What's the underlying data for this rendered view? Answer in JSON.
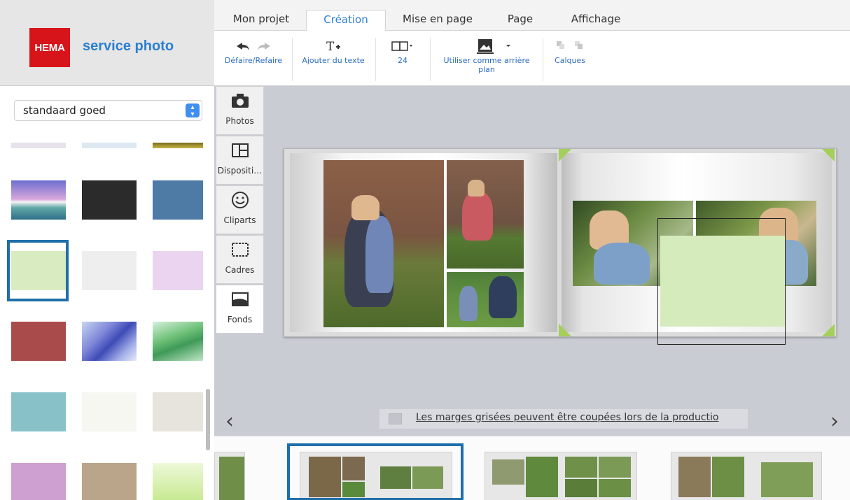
{
  "brand": {
    "logo_text": "HEMA",
    "name": "service photo",
    "logo_color": "#d8141b",
    "name_color": "#2b7fd0"
  },
  "tabs": [
    {
      "label": "Mon projet",
      "active": false
    },
    {
      "label": "Création",
      "active": true
    },
    {
      "label": "Mise en page",
      "active": false
    },
    {
      "label": "Page",
      "active": false
    },
    {
      "label": "Affichage",
      "active": false
    }
  ],
  "toolbar": {
    "undo_redo_label": "Défaire/Refaire",
    "add_text_label": "Ajouter du texte",
    "pages_count": "24",
    "use_background_label": "Utiliser comme arrière plan",
    "layers_label": "Calques"
  },
  "backgrounds": {
    "selected_option": "standaard goed",
    "selected_swatch_color": "#d9ebc0",
    "swatches": [
      "#e6e3ea",
      "#dde8f2",
      "#b69a2a",
      "#a7a9d6",
      "#2b2b2b",
      "#4e7aa6",
      "#d9ebc0",
      "#eeeeee",
      "#ead4ef",
      "#aa4b4b",
      "#8a8fd6",
      "#7fc086",
      "#88c2c8",
      "#f7f7f2",
      "#e7e4de",
      "#cda0d1",
      "#baa58b",
      "#d2ee9d"
    ]
  },
  "side_tools": [
    {
      "label": "Photos",
      "icon": "camera-icon"
    },
    {
      "label": "Dispositi…",
      "icon": "layout-icon"
    },
    {
      "label": "Cliparts",
      "icon": "smiley-icon"
    },
    {
      "label": "Cadres",
      "icon": "frame-icon"
    },
    {
      "label": "Fonds",
      "icon": "background-icon"
    }
  ],
  "canvas": {
    "margin_note": "Les marges grisées peuvent être coupées lors de la productio",
    "prev_arrow": "‹",
    "next_arrow": "›",
    "accent_color": "#1f6ea9",
    "corner_marker_color": "#a4cf5a"
  }
}
